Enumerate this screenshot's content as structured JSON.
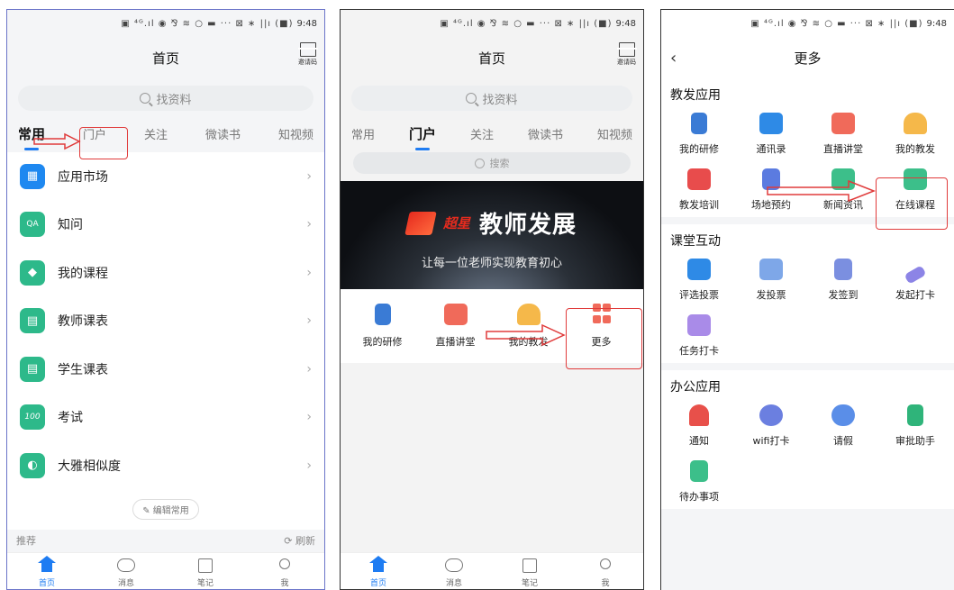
{
  "status": {
    "time": "9:48",
    "icons": "▣ ⁴ᴳ.ıl ◉ ⅋ ≋ ○ ▬ ··· ⊠ ∗ ||ı (■)"
  },
  "phone1": {
    "title": "首页",
    "invite_label": "邀请码",
    "search_placeholder": "找资料",
    "tabs": [
      {
        "label": "常用",
        "active": true
      },
      {
        "label": "门户",
        "active": false
      },
      {
        "label": "关注",
        "active": false
      },
      {
        "label": "微读书",
        "active": false
      },
      {
        "label": "知视频",
        "active": false
      }
    ],
    "list": [
      {
        "label": "应用市场",
        "icon": "grid-icon",
        "glyph": "▦",
        "color": "#1e88f0"
      },
      {
        "label": "知问",
        "icon": "qa-icon",
        "glyph": "QA",
        "color": "#2db98a"
      },
      {
        "label": "我的课程",
        "icon": "graduation-cap-icon",
        "glyph": "◆",
        "color": "#2db98a"
      },
      {
        "label": "教师课表",
        "icon": "calendar-icon",
        "glyph": "▤",
        "color": "#2db98a"
      },
      {
        "label": "学生课表",
        "icon": "calendar-icon",
        "glyph": "▤",
        "color": "#2db98a"
      },
      {
        "label": "考试",
        "icon": "exam-icon",
        "glyph": "100",
        "color": "#2db98a"
      },
      {
        "label": "大雅相似度",
        "icon": "similarity-icon",
        "glyph": "◐",
        "color": "#2db98a"
      }
    ],
    "edit_label": "编辑常用",
    "recommend_label": "推荐",
    "refresh_label": "刷新"
  },
  "phone2": {
    "title": "首页",
    "invite_label": "邀请码",
    "search_placeholder": "找资料",
    "tabs": [
      {
        "label": "常用",
        "active": false
      },
      {
        "label": "门户",
        "active": true
      },
      {
        "label": "关注",
        "active": false
      },
      {
        "label": "微读书",
        "active": false
      },
      {
        "label": "知视频",
        "active": false
      }
    ],
    "sub_search_placeholder": "搜索",
    "banner": {
      "brand": "超星",
      "title": "教师发展",
      "slogan": "让每一位老师实现教育初心"
    },
    "quick": [
      {
        "label": "我的研修",
        "icon": "clipboard-icon",
        "color": "#3a7bd5"
      },
      {
        "label": "直播讲堂",
        "icon": "video-icon",
        "color": "#f06a5a"
      },
      {
        "label": "我的教发",
        "icon": "teacher-icon",
        "color": "#f5b84a"
      },
      {
        "label": "更多",
        "icon": "more-icon",
        "color": "#f06a5a"
      }
    ]
  },
  "phone3": {
    "title": "更多",
    "sections": [
      {
        "title": "教发应用",
        "items": [
          {
            "label": "我的研修",
            "icon": "clipboard-icon",
            "color": "#3a7bd5"
          },
          {
            "label": "通讯录",
            "icon": "contacts-icon",
            "color": "#2e8ae6"
          },
          {
            "label": "直播讲堂",
            "icon": "video-icon",
            "color": "#f06a5a"
          },
          {
            "label": "我的教发",
            "icon": "teacher-icon",
            "color": "#f5b84a"
          },
          {
            "label": "教发培训",
            "icon": "training-icon",
            "color": "#e84c4c"
          },
          {
            "label": "场地预约",
            "icon": "building-icon",
            "color": "#5b7be0"
          },
          {
            "label": "新闻资讯",
            "icon": "news-icon",
            "color": "#3cbf8a"
          },
          {
            "label": "在线课程",
            "icon": "online-course-icon",
            "color": "#3cbf8a"
          }
        ]
      },
      {
        "title": "课堂互动",
        "items": [
          {
            "label": "评选投票",
            "icon": "vote-icon",
            "color": "#2e8ae6"
          },
          {
            "label": "发投票",
            "icon": "ballot-icon",
            "color": "#7ea7e8"
          },
          {
            "label": "发签到",
            "icon": "checkin-icon",
            "color": "#7b8fe0"
          },
          {
            "label": "发起打卡",
            "icon": "punch-icon",
            "color": "#8c84e6"
          },
          {
            "label": "任务打卡",
            "icon": "task-calendar-icon",
            "color": "#a98be8"
          }
        ]
      },
      {
        "title": "办公应用",
        "items": [
          {
            "label": "通知",
            "icon": "bell-icon",
            "color": "#e8504a"
          },
          {
            "label": "wifi打卡",
            "icon": "wifi-icon",
            "color": "#6b7fe0"
          },
          {
            "label": "请假",
            "icon": "leave-icon",
            "color": "#5a8ee8"
          },
          {
            "label": "审批助手",
            "icon": "stamp-icon",
            "color": "#2fb47a"
          },
          {
            "label": "待办事项",
            "icon": "todo-icon",
            "color": "#3cbf8a"
          }
        ]
      }
    ]
  },
  "nav": [
    {
      "label": "首页",
      "icon": "home-icon"
    },
    {
      "label": "消息",
      "icon": "message-icon"
    },
    {
      "label": "笔记",
      "icon": "note-icon"
    },
    {
      "label": "我",
      "icon": "profile-icon"
    }
  ]
}
